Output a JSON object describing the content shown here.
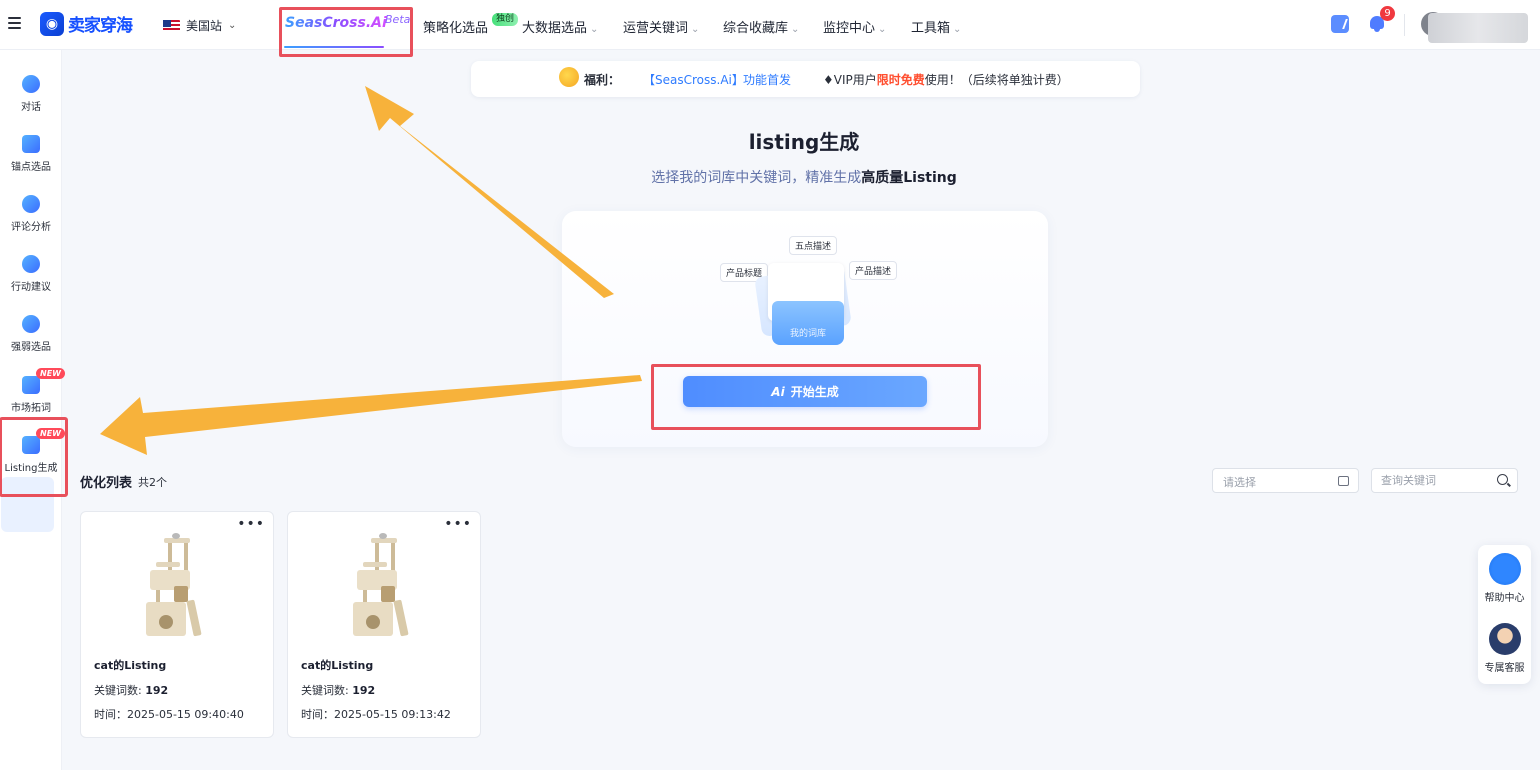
{
  "brand": {
    "logo_text": "卖家穿海"
  },
  "site": {
    "label": "美国站"
  },
  "nav": {
    "seascross": "SeasCross.Ai",
    "beta": "Beta",
    "items": [
      {
        "label": "策略化选品",
        "badge": "独创",
        "chevron": ""
      },
      {
        "label": "大数据选品",
        "chevron": "⌄"
      },
      {
        "label": "运营关键词",
        "chevron": "⌄"
      },
      {
        "label": "综合收藏库",
        "chevron": "⌄"
      },
      {
        "label": "监控中心",
        "chevron": "⌄"
      },
      {
        "label": "工具箱",
        "chevron": "⌄"
      }
    ]
  },
  "header": {
    "notification_count": "9"
  },
  "sidebar": {
    "items": [
      {
        "label": "对话"
      },
      {
        "label": "锚点选品"
      },
      {
        "label": "评论分析"
      },
      {
        "label": "行动建议"
      },
      {
        "label": "强弱选品"
      },
      {
        "label": "市场拓词",
        "badge": "NEW"
      },
      {
        "label": "Listing生成",
        "badge": "NEW"
      }
    ]
  },
  "banner": {
    "fuli": "福利：",
    "bracket": "【SeasCross.Ai】",
    "feature": "功能首发",
    "vip_prefix": "♦VIP用户",
    "vip_red": "限时免费",
    "vip_suffix": "使用！（后续将单独计费）"
  },
  "hero": {
    "title": "listing生成",
    "subtitle_prefix": "选择我的词库中关键词，精准生成",
    "subtitle_bold": "高质量Listing"
  },
  "generator": {
    "tag_top": "五点描述",
    "tag_left": "产品标题",
    "tag_right": "产品描述",
    "folder_label": "我的词库",
    "button_ai": "Ai",
    "button_label": "开始生成"
  },
  "list": {
    "title": "优化列表",
    "count": "共2个",
    "date_placeholder": "请选择",
    "search_placeholder": "查询关键词"
  },
  "cards": [
    {
      "name": "cat的Listing",
      "kw_label": "关键词数:",
      "kw_value": "192",
      "time_label": "时间：",
      "time_value": "2025-05-15 09:40:40"
    },
    {
      "name": "cat的Listing",
      "kw_label": "关键词数:",
      "kw_value": "192",
      "time_label": "时间：",
      "time_value": "2025-05-15 09:13:42"
    }
  ],
  "float_panel": {
    "help": "帮助中心",
    "service": "专属客服"
  },
  "colors": {
    "primary": "#2e7bff",
    "highlight_box": "#e8505b",
    "arrow": "#f7b23b",
    "badge_red": "#ff4a5a"
  }
}
